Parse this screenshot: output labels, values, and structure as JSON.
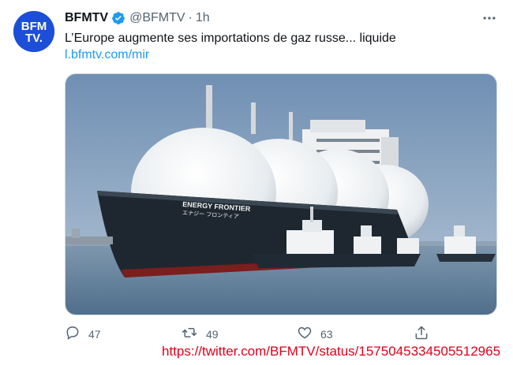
{
  "tweet": {
    "display_name": "BFMTV",
    "handle": "@BFMTV",
    "separator": "·",
    "time": "1h",
    "text": "L’Europe augmente ses importations de gaz russe... liquide",
    "link": "l.bfmtv.com/mir",
    "avatar_text_line1": "BFM",
    "avatar_text_line2": "TV.",
    "ship_name": "ENERGY FRONTIER",
    "ship_name_jp": "エナジー フロンティア"
  },
  "actions": {
    "reply_count": "47",
    "retweet_count": "49",
    "like_count": "63"
  },
  "source_url": "https://twitter.com/BFMTV/status/1575045334505512965",
  "colors": {
    "link": "#1d9bf0",
    "verified": "#1d9bf0",
    "avatar_bg": "#1d4ed8",
    "url_overlay": "#e0001a",
    "muted": "#536471"
  },
  "icons": {
    "verified": "verified-badge-icon",
    "more": "more-icon",
    "reply": "reply-icon",
    "retweet": "retweet-icon",
    "like": "heart-icon",
    "share": "share-icon"
  }
}
